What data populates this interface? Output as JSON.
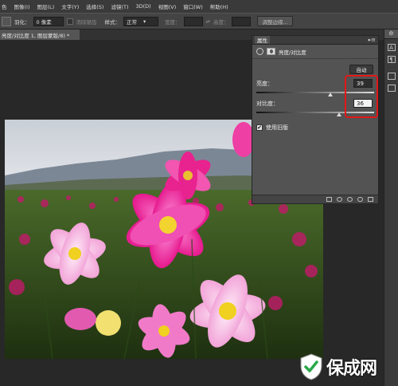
{
  "menubar": {
    "items": [
      "色",
      "图像(I)",
      "图层(L)",
      "文字(Y)",
      "选择(S)",
      "滤镜(T)",
      "3D(D)",
      "视图(V)",
      "窗口(W)",
      "帮助(H)"
    ]
  },
  "optionsbar": {
    "feather_label": "羽化：",
    "feather_value": "0 像素",
    "antialias_label": "消除锯齿",
    "style_label": "样式：",
    "style_value": "正常",
    "width_label": "宽度：",
    "height_label": "高度：",
    "refine_edge_label": "调整边缘..."
  },
  "document": {
    "tab_title": "亮度/对比度 1, 图层蒙版/8) *"
  },
  "properties": {
    "panel_title": "属性",
    "header_title": "亮度/对比度",
    "auto_label": "自动",
    "brightness_label": "亮度：",
    "brightness_value": "39",
    "contrast_label": "对比度：",
    "contrast_value": "36",
    "use_legacy_label": "使用旧版",
    "use_legacy_checked": "✔"
  },
  "sliders": {
    "brightness_fraction": 0.63,
    "contrast_fraction": 0.7
  },
  "rightstrip": {
    "top_label": "命"
  },
  "watermark": {
    "text": "保成网"
  },
  "colors": {
    "menubar": "#3a3a3a",
    "panel": "#535353",
    "highlight_outline": "#e01818"
  }
}
